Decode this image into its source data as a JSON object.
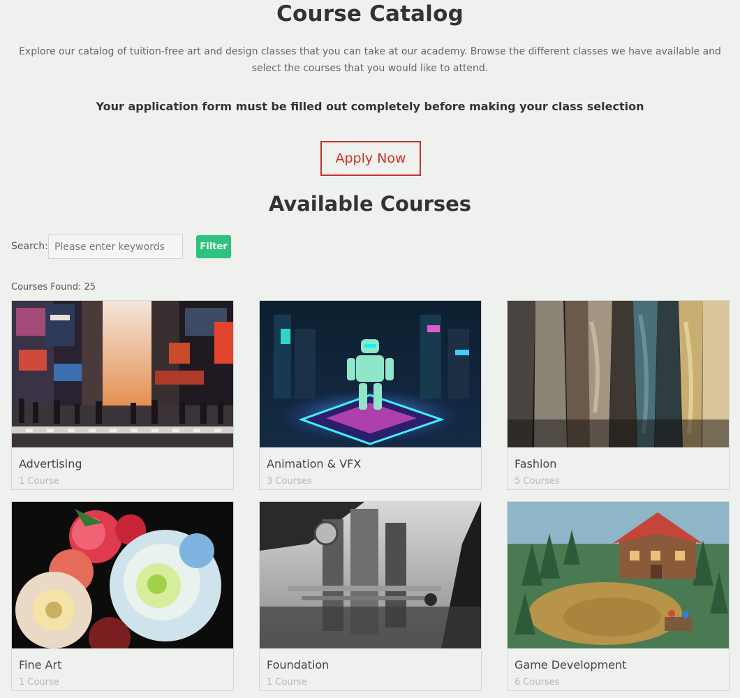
{
  "header": {
    "title": "Course Catalog",
    "intro": "Explore our catalog of tuition-free art and design classes that you can take at our academy. Browse the different classes we have available and select the courses that you would like to attend.",
    "notice": "Your application form must be filled out completely before making your class selection",
    "apply_label": "Apply Now"
  },
  "courses_section": {
    "title": "Available Courses",
    "search_label": "Search:",
    "search_placeholder": "Please enter keywords",
    "search_value": "",
    "filter_label": "Filter",
    "found_text": "Courses Found: 25"
  },
  "colors": {
    "accent_red": "#c8312a",
    "filter_green": "#2ec27e",
    "background": "#eff1ee"
  },
  "courses": [
    {
      "name": "Advertising",
      "count": "1 Course",
      "image": "city-street-night-photo"
    },
    {
      "name": "Animation & VFX",
      "count": "3 Courses",
      "image": "neon-robot-scene"
    },
    {
      "name": "Fashion",
      "count": "5 Courses",
      "image": "hanging-clothes-photo"
    },
    {
      "name": "Fine Art",
      "count": "1 Course",
      "image": "peony-flowers-painting"
    },
    {
      "name": "Foundation",
      "count": "1 Course",
      "image": "grayscale-scifi-environment"
    },
    {
      "name": "Game Development",
      "count": "6 Courses",
      "image": "fantasy-village-scene"
    }
  ]
}
